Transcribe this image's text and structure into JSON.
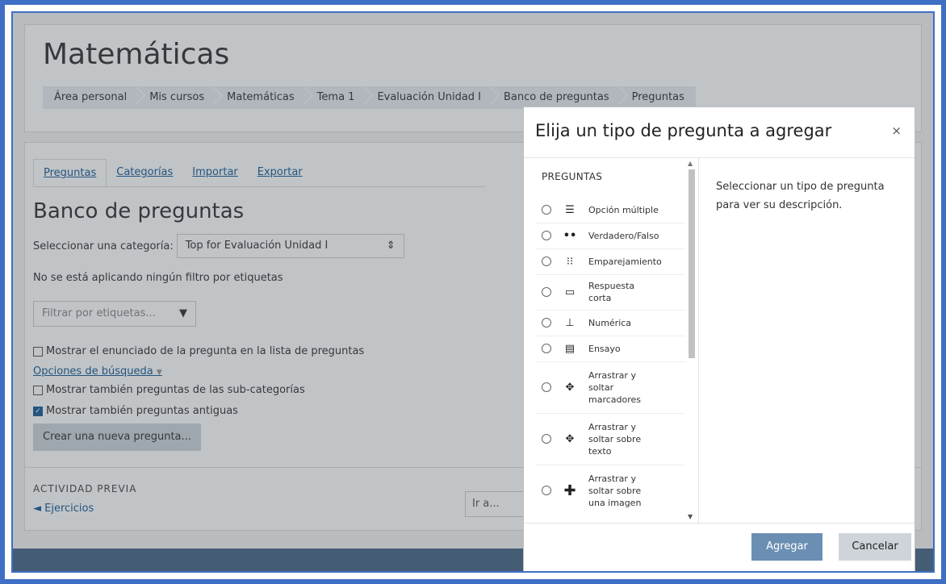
{
  "course": {
    "title": "Matemáticas"
  },
  "breadcrumb": [
    "Área personal",
    "Mis cursos",
    "Matemáticas",
    "Tema 1",
    "Evaluación Unidad I",
    "Banco de preguntas",
    "Preguntas"
  ],
  "tabs": [
    "Preguntas",
    "Categorías",
    "Importar",
    "Exportar"
  ],
  "bank": {
    "title": "Banco de preguntas",
    "category_label": "Seleccionar una categoría:",
    "category_value": "Top for Evaluación Unidad I",
    "no_filter_text": "No se está aplicando ningún filtro por etiquetas",
    "tag_filter_placeholder": "Filtrar por etiquetas...",
    "show_text_label": "Mostrar el enunciado de la pregunta en la lista de preguntas",
    "search_options_label": "Opciones de búsqueda",
    "show_subcats_label": "Mostrar también preguntas de las sub-categorías",
    "show_old_label": "Mostrar también preguntas antiguas",
    "create_button": "Crear una nueva pregunta..."
  },
  "activity": {
    "title": "ACTIVIDAD PREVIA",
    "prev_link": "◄ Ejercicios",
    "goto": "Ir a..."
  },
  "modal": {
    "title": "Elija un tipo de pregunta a agregar",
    "close": "×",
    "section": "PREGUNTAS",
    "description": "Seleccionar un tipo de pregunta para ver su descripción.",
    "options": [
      {
        "label": "Opción múltiple",
        "icon": "list-icon"
      },
      {
        "label": "Verdadero/Falso",
        "icon": "two-dots-icon"
      },
      {
        "label": "Emparejamiento",
        "icon": "matching-icon"
      },
      {
        "label": "Respuesta corta",
        "icon": "short-answer-icon"
      },
      {
        "label": "Numérica",
        "icon": "numeric-icon"
      },
      {
        "label": "Ensayo",
        "icon": "essay-icon"
      },
      {
        "label": "Arrastrar y soltar marcadores",
        "icon": "move-markers-icon"
      },
      {
        "label": "Arrastrar y soltar sobre texto",
        "icon": "move-text-icon"
      },
      {
        "label": "Arrastrar y soltar sobre una imagen",
        "icon": "move-image-icon"
      }
    ],
    "add_button": "Agregar",
    "cancel_button": "Cancelar"
  },
  "colors": {
    "frame": "#3f6fc4",
    "primary": "#6b8fb3",
    "link": "#1a5a96"
  }
}
